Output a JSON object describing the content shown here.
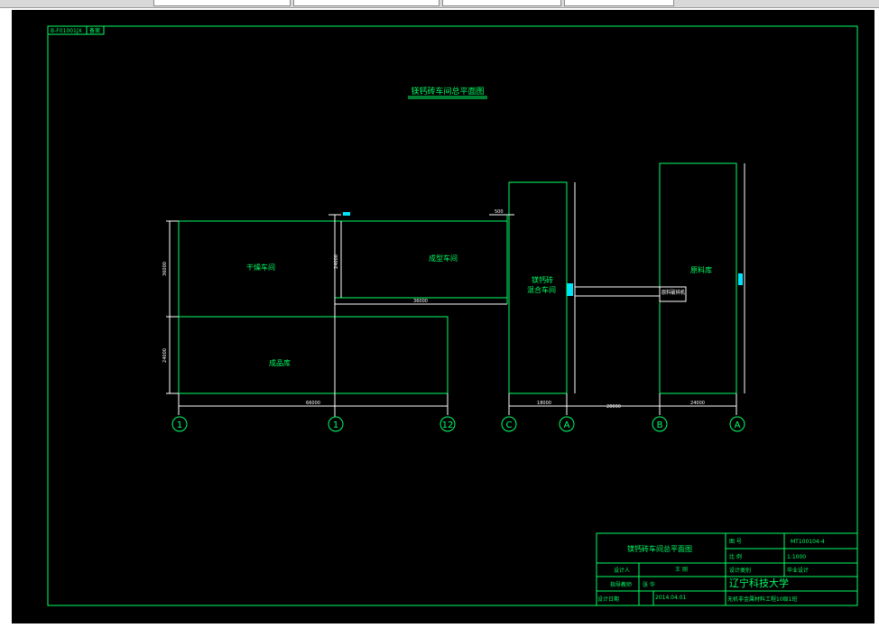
{
  "drawing": {
    "corner_tag": "B-F01001JX",
    "corner_tag2": "备案",
    "title": "镁钙砖车间总平面图",
    "rooms": {
      "drying": "干燥车间",
      "forming": "成型车间",
      "product": "成品库",
      "mixing_line1": "镁钙砖",
      "mixing_line2": "混合车间",
      "raw": "原料库",
      "crusher": "原料破碎机"
    },
    "dimensions": {
      "d_500": "500",
      "d_24000a": "24000",
      "d_36000": "36000",
      "d_36000b": "36000",
      "d_24000b": "24000",
      "d_66000": "66000",
      "d_18000": "18000",
      "d_28000": "28000",
      "d_24000c": "24000"
    },
    "axis_labels": [
      "1",
      "1",
      "12",
      "C",
      "A",
      "B",
      "A"
    ]
  },
  "title_block": {
    "drawing_name": "镁钙砖车间总平面图",
    "label_code": "图  号",
    "code": "MT100104-4",
    "label_scale": "比  例",
    "scale": "1:1000",
    "label_designer": "设计人",
    "designer": "王  刚",
    "label_category": "设计类别",
    "category": "毕业设计",
    "label_advisor": "指导教师",
    "advisor": "张  华",
    "university": "辽宁科技大学",
    "label_date": "设计日期",
    "date": "2014.04.01",
    "class": "无机非金属材料工程10级1班"
  },
  "colors": {
    "green": "#00ff66",
    "cyan": "#00e5ff",
    "background": "#000000",
    "frame": "#ffffff"
  }
}
